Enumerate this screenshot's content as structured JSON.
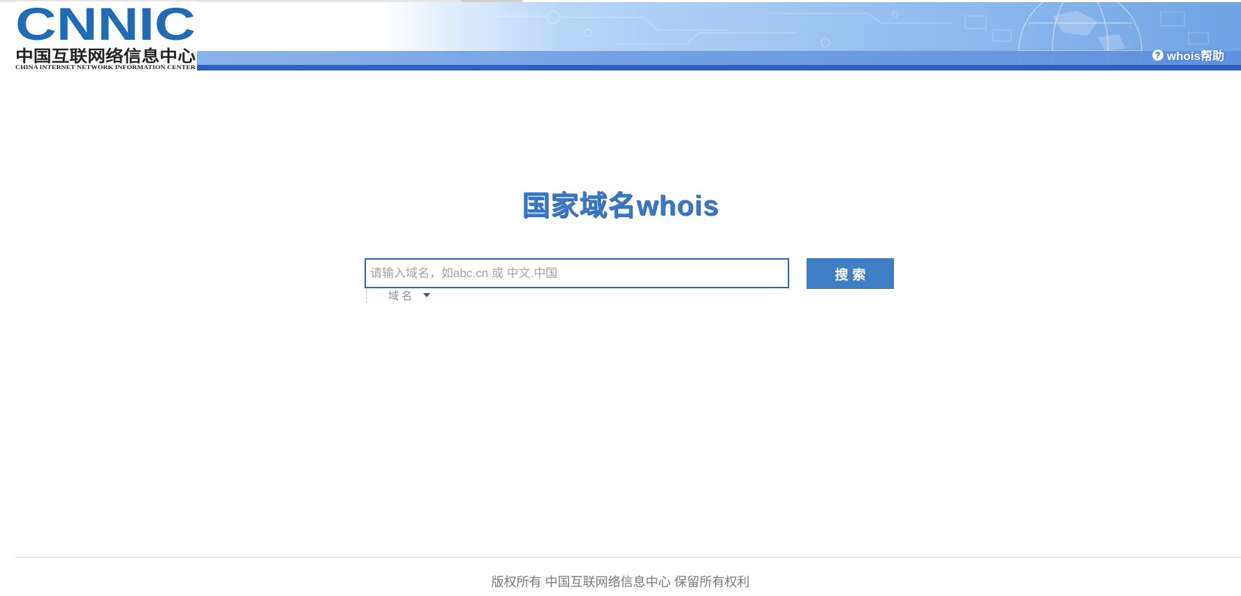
{
  "header": {
    "logo_text": "CNNIC",
    "logo_subtitle_cn": "中国互联网络信息中心",
    "logo_subtitle_en": "CHINA INTERNET NETWORK INFORMATION CENTER",
    "help_label": "whois帮助",
    "help_icon": "question-circle-icon"
  },
  "main": {
    "title": "国家域名whois",
    "search": {
      "placeholder": "请输入域名，如abc.cn 或 中文.中国",
      "value": "",
      "button_label": "搜索"
    },
    "type_select": {
      "selected": "域名"
    }
  },
  "footer": {
    "copyright": "版权所有 中国互联网络信息中心 保留所有权利"
  },
  "colors": {
    "brand_blue": "#1f6bb5",
    "accent": "#3f7fc6",
    "border": "#2f62bf"
  }
}
